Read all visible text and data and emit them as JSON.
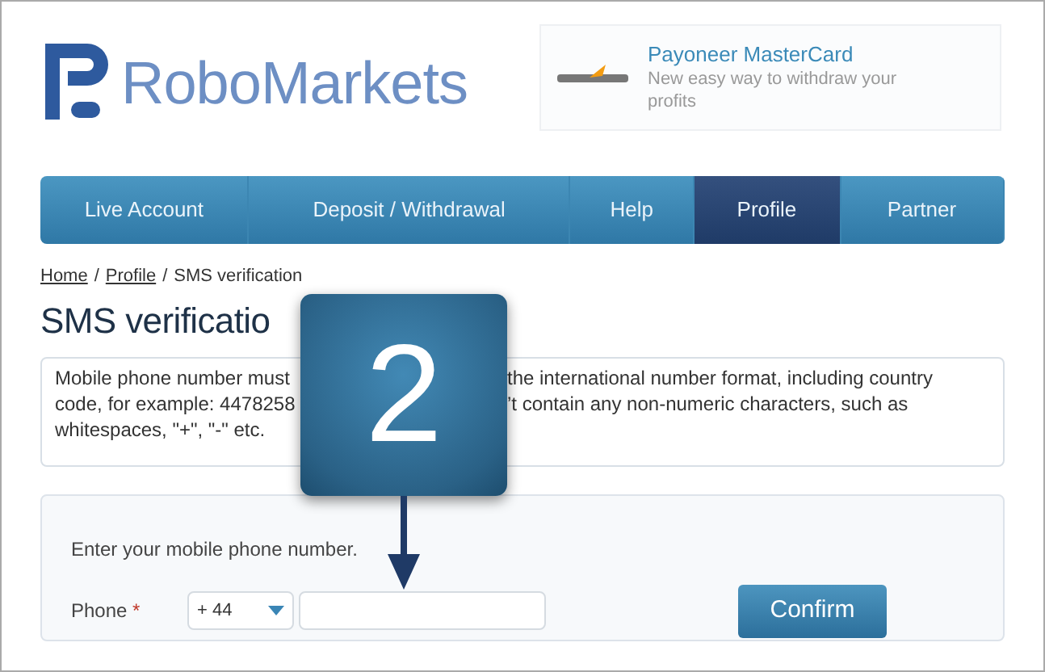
{
  "logo": {
    "text": "RoboMarkets"
  },
  "ad": {
    "title": "Payoneer MasterCard",
    "text": "New easy way to withdraw your profits"
  },
  "nav": [
    {
      "label": "Live Account",
      "selected": false
    },
    {
      "label": "Deposit / Withdrawal",
      "selected": false
    },
    {
      "label": "Help",
      "selected": false
    },
    {
      "label": "Profile",
      "selected": true
    },
    {
      "label": "Partner",
      "selected": false
    }
  ],
  "breadcrumb": {
    "separator": "/",
    "items": [
      {
        "label": "Home",
        "kind": "link"
      },
      {
        "label": "Profile",
        "kind": "link"
      },
      {
        "label": "SMS verification",
        "kind": "current"
      }
    ]
  },
  "title": "SMS verificatio",
  "notice": {
    "lines": [
      [
        "Mobile phone number must",
        "the international number format, including country"
      ],
      [
        "code, for example: 4478258",
        "’t contain any non-numeric characters, such as"
      ],
      [
        "whitespaces, \"+\", \"-\" etc."
      ]
    ]
  },
  "callout": {
    "text": "2"
  },
  "form": {
    "prompt": "Enter your mobile phone number.",
    "phone_label": "Phone",
    "required": true,
    "required_mark": "*",
    "country_code": "+ 44",
    "confirm": "Confirm"
  }
}
